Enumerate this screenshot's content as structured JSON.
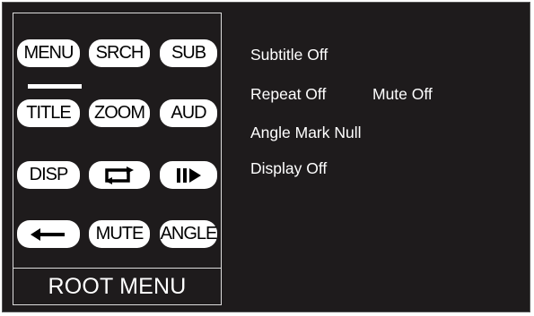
{
  "menu": {
    "footer_label": "ROOT MENU",
    "buttons": {
      "menu": "MENU",
      "search": "SRCH",
      "subtitle": "SUB",
      "title": "TITLE",
      "zoom": "ZOOM",
      "audio": "AUD",
      "display": "DISP",
      "mute": "MUTE",
      "angle": "ANGLE"
    },
    "icons": {
      "repeat": "repeat-icon",
      "step": "step-forward-icon",
      "back": "back-arrow-icon"
    },
    "selected": "MENU"
  },
  "status": {
    "subtitle": "Subtitle Off",
    "repeat": "Repeat Off",
    "mute": "Mute Off",
    "angle": "Angle Mark Null",
    "display": "Display Off"
  },
  "colors": {
    "background": "#1e1b1c",
    "button": "#ffffff",
    "text": "#ffffff"
  }
}
